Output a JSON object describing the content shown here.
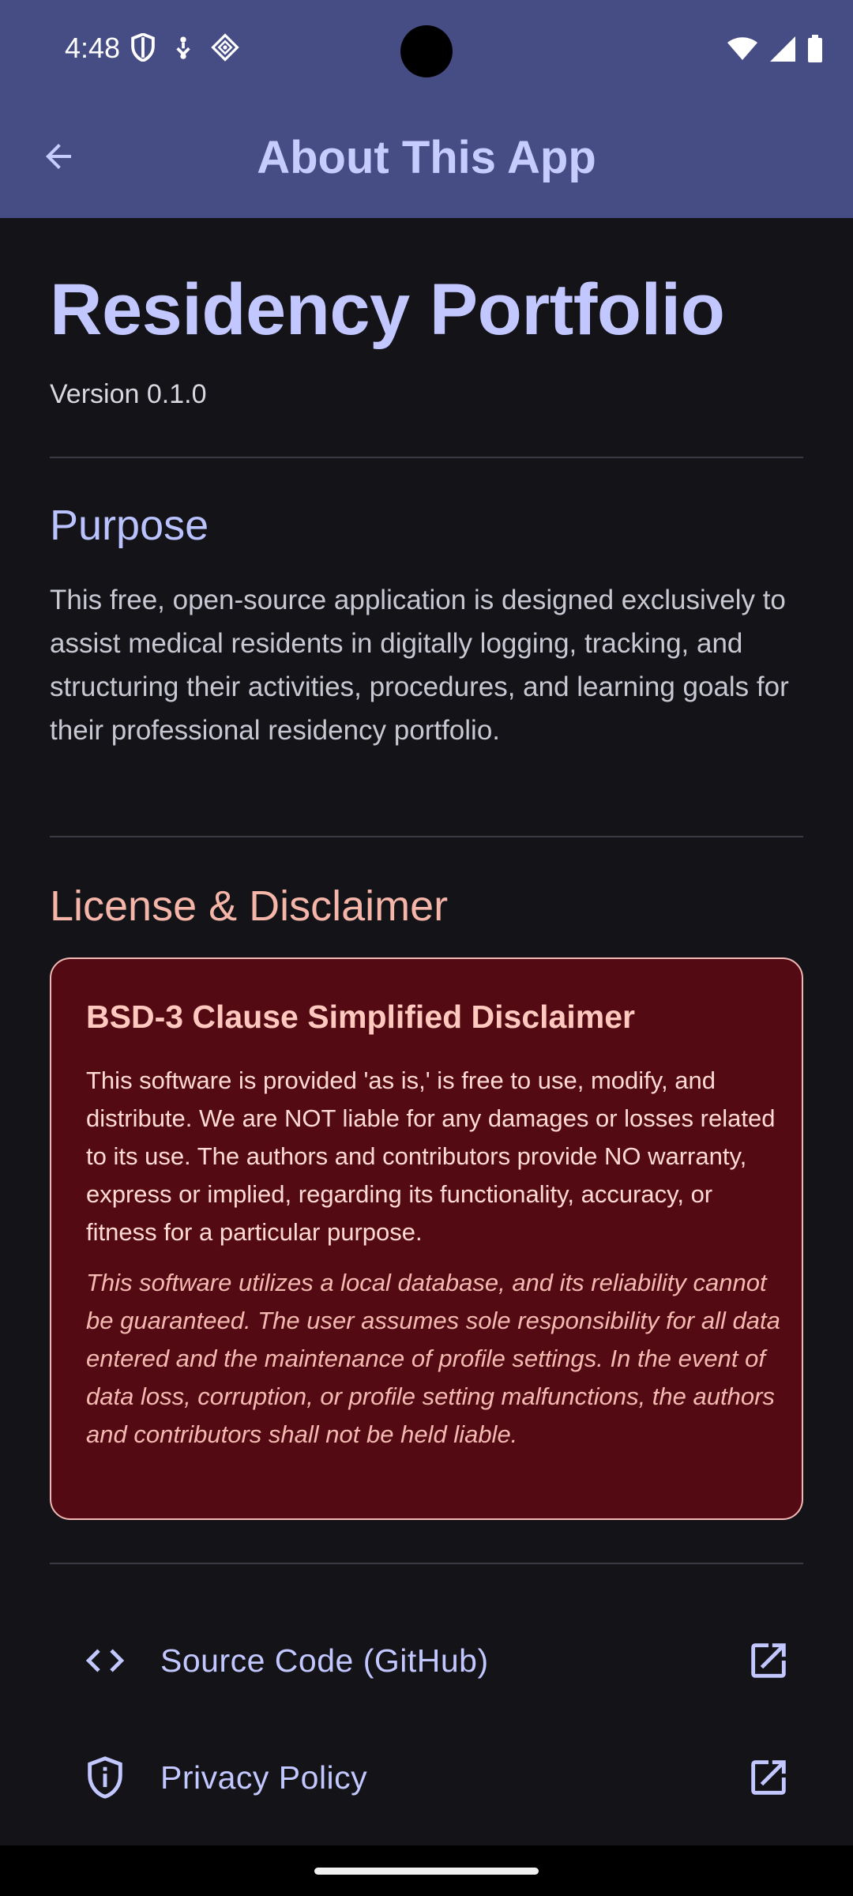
{
  "status_bar": {
    "time": "4:48",
    "left_icons": [
      "shield-icon",
      "usb-debug-icon",
      "data-sync-icon"
    ],
    "right_icons": [
      "wifi-icon",
      "signal-icon",
      "battery-icon"
    ]
  },
  "app_bar": {
    "title": "About This App",
    "back_icon": "arrow-back-icon"
  },
  "header": {
    "app_name": "Residency Portfolio",
    "version": "Version 0.1.0"
  },
  "purpose": {
    "heading": "Purpose",
    "body": "This free, open-source application is designed exclusively to assist medical residents in digitally logging, tracking, and structuring their activities, procedures, and learning goals for their professional residency portfolio."
  },
  "license": {
    "heading": "License & Disclaimer",
    "card_title": "BSD-3 Clause Simplified Disclaimer",
    "card_body": "This software is provided 'as is,' is free to use, modify, and distribute. We are NOT liable for any damages or losses related to its use. The authors and contributors provide NO warranty, express or implied, regarding its functionality, accuracy, or fitness for a particular purpose.",
    "card_note": "This software utilizes a local database, and its reliability cannot be guaranteed. The user assumes sole responsibility for all data entered and the maintenance of profile settings. In the event of data loss, corruption, or profile setting malfunctions, the authors and contributors shall not be held liable."
  },
  "links": [
    {
      "label": "Source Code (GitHub)",
      "icon": "code-icon",
      "trailing_icon": "open-in-new-icon"
    },
    {
      "label": "Privacy Policy",
      "icon": "shield-info-icon",
      "trailing_icon": "open-in-new-icon"
    }
  ],
  "colors": {
    "app_bar": "#464D84",
    "background": "#131318",
    "accent": "#C2C8FF",
    "error_container": "#540A12",
    "error_on_container": "#FFDAD5"
  }
}
